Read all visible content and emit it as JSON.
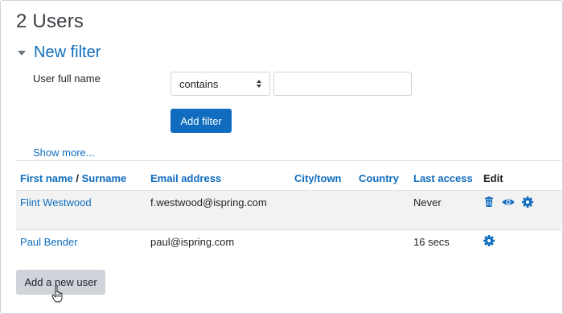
{
  "page": {
    "title": "2 Users"
  },
  "filter": {
    "heading": "New filter",
    "field_label": "User full name",
    "operator": "contains",
    "value": "",
    "add_button": "Add filter",
    "show_more": "Show more..."
  },
  "table": {
    "headers": {
      "first_name": "First name",
      "separator": "/",
      "surname": "Surname",
      "email": "Email address",
      "city": "City/town",
      "country": "Country",
      "last_access": "Last access",
      "edit": "Edit"
    },
    "rows": [
      {
        "name": "Flint Westwood",
        "email": "f.westwood@ispring.com",
        "city": "",
        "country": "",
        "last_access": "Never",
        "actions": [
          "trash-icon",
          "eye-icon",
          "gear-icon"
        ]
      },
      {
        "name": "Paul Bender",
        "email": "paul@ispring.com",
        "city": "",
        "country": "",
        "last_access": "16 secs",
        "actions": [
          "gear-icon"
        ]
      }
    ]
  },
  "add_user_button": "Add a new user",
  "colors": {
    "link": "#0f6cbf",
    "primary_button": "#0f6cbf",
    "secondary_button": "#ced4da",
    "stripe": "#f2f2f2"
  }
}
